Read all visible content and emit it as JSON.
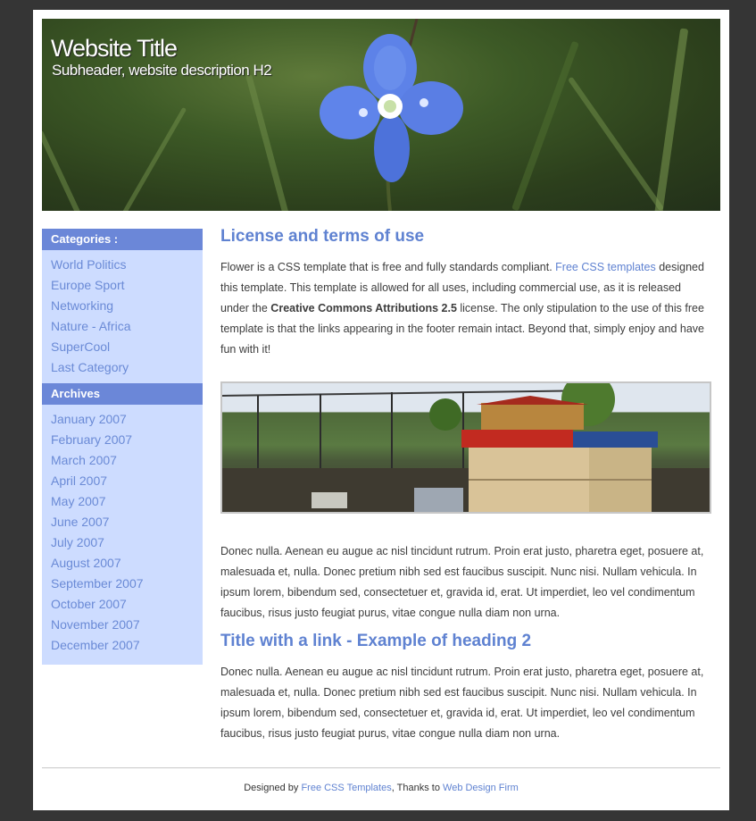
{
  "header": {
    "title": "Website Title",
    "subtitle": "Subheader, website description H2"
  },
  "sidebar": {
    "categories_title": "Categories :",
    "categories": [
      "World Politics",
      "Europe Sport",
      "Networking",
      "Nature - Africa",
      "SuperCool",
      "Last Category"
    ],
    "archives_title": "Archives",
    "archives": [
      "January 2007",
      "February 2007",
      "March 2007",
      "April 2007",
      "May 2007",
      "June 2007",
      "July 2007",
      "August 2007",
      "September 2007",
      "October 2007",
      "November 2007",
      "December 2007"
    ]
  },
  "main": {
    "heading1": "License and terms of use",
    "intro": {
      "part1": "Flower is a CSS template that is free and fully standards compliant. ",
      "link": "Free CSS templates",
      "part2": " designed this template. This template is allowed for all uses, including commercial use, as it is released under the ",
      "bold": "Creative Commons Attributions 2.5",
      "part3": " license. The only stipulation to the use of this free template is that the links appearing in the footer remain intact. Beyond that, simply enjoy and have fun with it!"
    },
    "paragraph2": "Donec nulla. Aenean eu augue ac nisl tincidunt rutrum. Proin erat justo, pharetra eget, posuere at, malesuada et, nulla. Donec pretium nibh sed est faucibus suscipit. Nunc nisi. Nullam vehicula. In ipsum lorem, bibendum sed, consectetuer et, gravida id, erat. Ut imperdiet, leo vel condimentum faucibus, risus justo feugiat purus, vitae congue nulla diam non urna.",
    "heading2": "Title with a link - Example of heading 2",
    "paragraph3": "Donec nulla. Aenean eu augue ac nisl tincidunt rutrum. Proin erat justo, pharetra eget, posuere at, malesuada et, nulla. Donec pretium nibh sed est faucibus suscipit. Nunc nisi. Nullam vehicula. In ipsum lorem, bibendum sed, consectetuer et, gravida id, erat. Ut imperdiet, leo vel condimentum faucibus, risus justo feugiat purus, vitae congue nulla diam non urna."
  },
  "footer": {
    "prefix": "Designed by ",
    "link1": "Free CSS Templates",
    "middle": ", Thanks to ",
    "link2": "Web Design Firm"
  },
  "colors": {
    "accent": "#5f82d1",
    "sidebar_header": "#6b87d8",
    "sidebar_background": "#cddcff",
    "page_background": "#353535"
  },
  "icons": {
    "header_image": "blue-flower-photo",
    "content_image": "beehive-garden-photo"
  }
}
